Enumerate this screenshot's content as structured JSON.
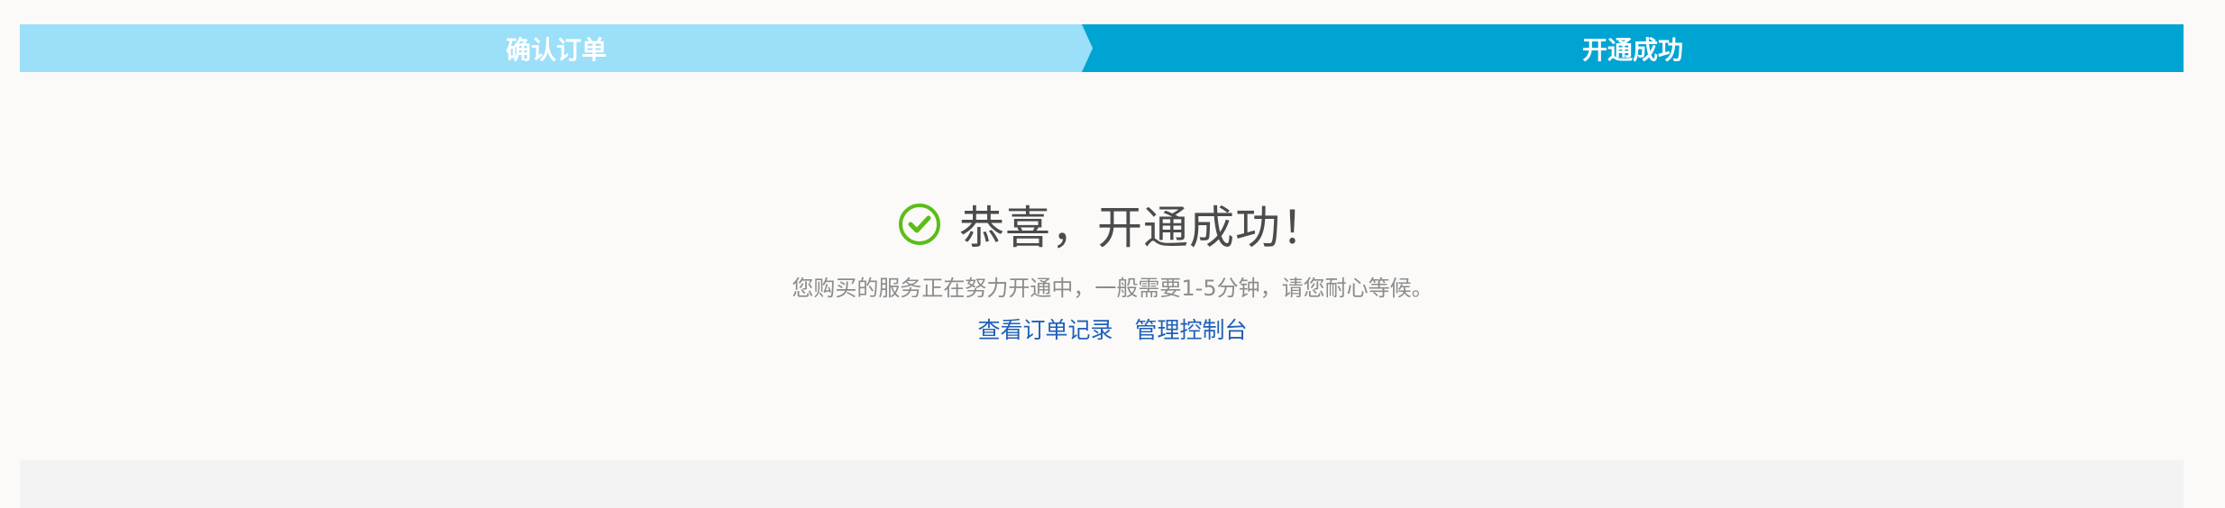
{
  "steps": [
    {
      "label": "确认订单"
    },
    {
      "label": "开通成功"
    }
  ],
  "result": {
    "title": "恭喜，开通成功！",
    "description": "您购买的服务正在努力开通中，一般需要1-5分钟，请您耐心等候。",
    "links": {
      "orders": "查看订单记录",
      "console": "管理控制台"
    },
    "icon": "check-circle-icon"
  },
  "colors": {
    "step_done": "#9cdff8",
    "step_active": "#00a4d2",
    "success": "#5cbd17",
    "link": "#1f60b8"
  }
}
